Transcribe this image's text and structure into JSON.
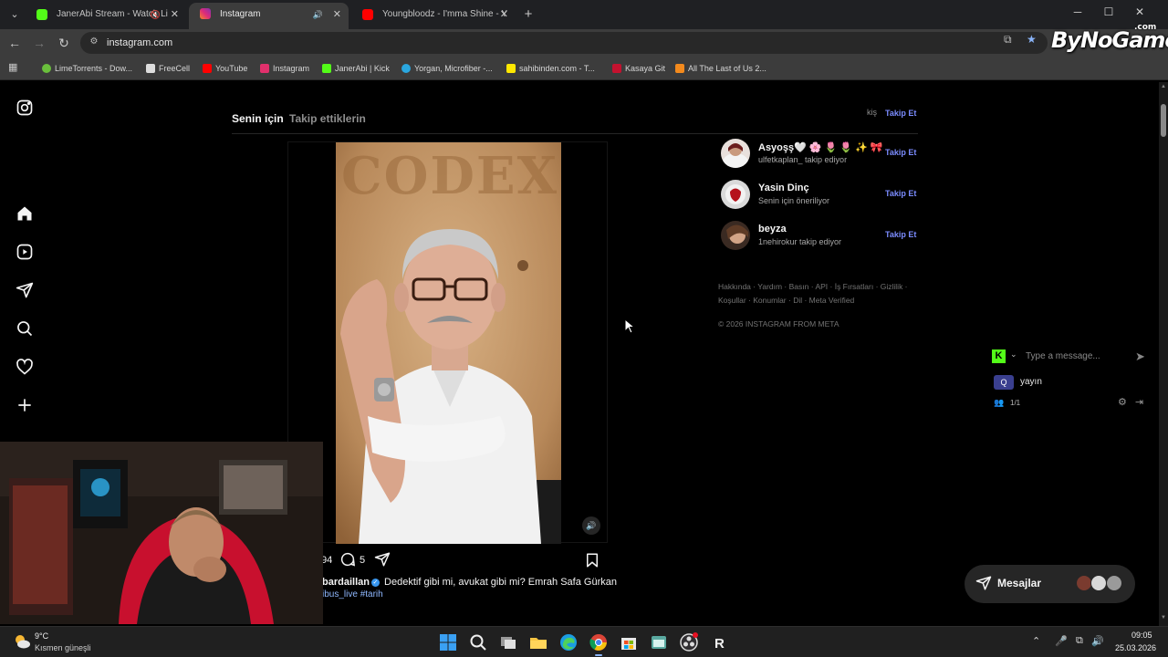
{
  "browser": {
    "tabs": [
      {
        "title": "JanerAbi Stream - Watch Li",
        "favicon_color": "#53fc18",
        "muted": true
      },
      {
        "title": "Instagram",
        "favicon_color": "#e1306c",
        "muted": false
      },
      {
        "title": "Youngbloodz - I'mma Shine - Y",
        "favicon_color": "#ff0000",
        "muted": false
      }
    ],
    "url": "instagram.com",
    "bookmarks": [
      {
        "label": "LimeTorrents - Dow...",
        "color": "#6abf3c"
      },
      {
        "label": "FreeCell",
        "color": "#dddddd"
      },
      {
        "label": "YouTube",
        "color": "#ff0000"
      },
      {
        "label": "Instagram",
        "color": "#e1306c"
      },
      {
        "label": "JanerAbi | Kick",
        "color": "#53fc18"
      },
      {
        "label": "Yorgan, Microfiber -...",
        "color": "#2aa7e0"
      },
      {
        "label": "sahibinden.com - T...",
        "color": "#ffe800"
      },
      {
        "label": "Kasaya Git",
        "color": "#c4122f"
      },
      {
        "label": "All The Last of Us 2...",
        "color": "#f38a1d"
      }
    ]
  },
  "watermark": {
    "brand": "ByNoGame",
    "suffix": ".com"
  },
  "instagram": {
    "feed_tabs": {
      "for_you": "Senin için",
      "following": "Takip ettiklerin"
    },
    "post": {
      "video_overlay_text": "CODEX",
      "likes_partial": "94",
      "comments": "5",
      "username": "bardaillan",
      "caption": "Dedektif gibi mi, avukat gibi mi? Emrah Safa Gürkan",
      "hashtag_prefix": "ibus_live",
      "hashtag": "#tarih"
    },
    "suggestions_header_partial": "kiş",
    "follow_label": "Takip Et",
    "suggestions": [
      {
        "name": "Asyoşş🤍 🌸 🌷 🌷 ✨ 🎀",
        "sub": "ulfetkaplan_ takip ediyor"
      },
      {
        "name": "Yasin Dinç",
        "sub": "Senin için öneriliyor"
      },
      {
        "name": "beyza",
        "sub": "1nehirokur takip ediyor"
      }
    ],
    "footer_line1": "Hakkında · Yardım · Basın · API · İş Fırsatları · Gizlilik ·",
    "footer_line2": "Koşullar · Konumlar · Dil · Meta Verified",
    "copyright": "© 2026 INSTAGRAM FROM META",
    "messages_label": "Mesajlar"
  },
  "chat_widget": {
    "placeholder": "Type a message...",
    "channel": "yayın",
    "count": "1/1"
  },
  "taskbar": {
    "temperature": "9°C",
    "weather": "Kısmen güneşli",
    "time": "09:05",
    "date": "25.03.2026"
  }
}
